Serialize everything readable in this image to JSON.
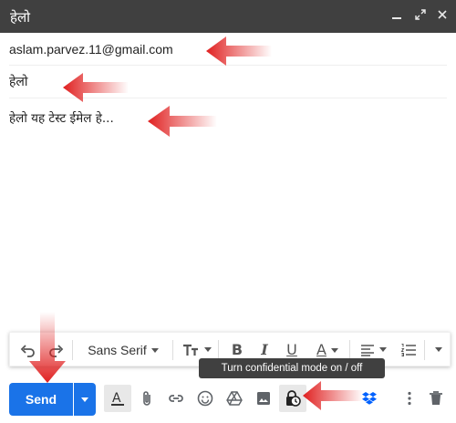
{
  "window": {
    "title": "हेलो"
  },
  "compose": {
    "to": "aslam.parvez.11@gmail.com",
    "subject": "हेलो",
    "body": "हेलो यह टेस्ट ईमेल हे..."
  },
  "format_bar": {
    "font_name": "Sans Serif"
  },
  "tooltip": {
    "text": "Turn confidential mode on / off"
  },
  "actions": {
    "send_label": "Send"
  },
  "colors": {
    "send": "#1a73e8",
    "titlebar": "#404040",
    "annotation_arrow": "#e02020",
    "dropbox": "#0061fe"
  }
}
